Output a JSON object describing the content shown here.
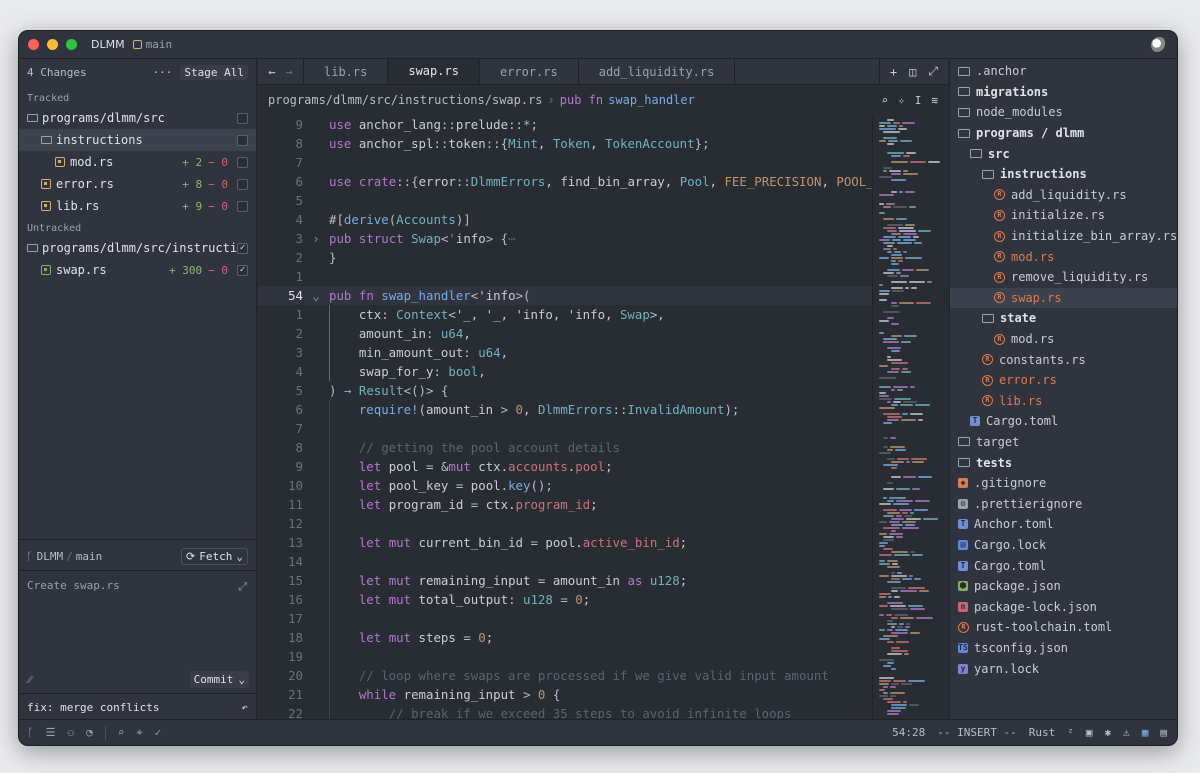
{
  "titlebar": {
    "project": "DLMM",
    "branch": "main"
  },
  "git_panel": {
    "changes_count": "4 Changes",
    "more": "···",
    "stage_all": "Stage All",
    "tracked_label": "Tracked",
    "untracked_label": "Untracked",
    "tracked": [
      {
        "label": "programs/dlmm/src"
      },
      {
        "label": "instructions"
      },
      {
        "label": "mod.rs",
        "add": "+ 2",
        "del": "− 0"
      },
      {
        "label": "error.rs",
        "add": "+ 8",
        "del": "− 0"
      },
      {
        "label": "lib.rs",
        "add": "+ 9",
        "del": "− 0"
      }
    ],
    "untracked": [
      {
        "label": "programs/dlmm/src/instructi…"
      },
      {
        "label": "swap.rs",
        "add": "+ 300",
        "del": "− 0"
      }
    ],
    "repo": "DLMM",
    "branch": "main",
    "fetch": "Fetch",
    "commit_placeholder": "Create swap.rs",
    "commit_button": "Commit",
    "last_commit": "fix: merge conflicts"
  },
  "tabs": [
    "lib.rs",
    "swap.rs",
    "error.rs",
    "add_liquidity.rs"
  ],
  "active_tab": "swap.rs",
  "breadcrumb": {
    "path": "programs/dlmm/src/instructions/swap.rs",
    "kw": "pub fn",
    "fn": "swap_handler"
  },
  "code_lines": [
    {
      "n": "9",
      "html": "<span class='k'>use</span> anchor_lang<span class='p'>::</span>prelude<span class='p'>::*;</span>"
    },
    {
      "n": "8",
      "html": "<span class='k'>use</span> anchor_spl<span class='p'>::</span>token<span class='p'>::{</span><span class='t'>Mint</span>, <span class='t'>Token</span>, <span class='t'>TokenAccount</span><span class='p'>};</span>"
    },
    {
      "n": "7",
      "html": ""
    },
    {
      "n": "6",
      "html": "<span class='k'>use</span> <span class='k'>crate</span><span class='p'>::{</span>error<span class='p'>::</span><span class='t'>DlmmErrors</span>, find_bin_array, <span class='t'>Pool</span>, <span class='n'>FEE_PRECISION</span>, <span class='n'>POOL_SEE</span>"
    },
    {
      "n": "5",
      "html": ""
    },
    {
      "n": "4",
      "html": "<span class='p'>#[</span><span class='f'>derive</span><span class='p'>(</span><span class='t'>Accounts</span><span class='p'>)]</span>"
    },
    {
      "n": "3",
      "fold": "›",
      "html": "<span class='k'>pub</span> <span class='k'>struct</span> <span class='t'>Swap</span><span class='p'>&lt;</span><span class='fld'>'</span>info<span class='p'>&gt; {</span><span class='c'>⋯</span>"
    },
    {
      "n": "2",
      "html": "<span class='p'>}</span>"
    },
    {
      "n": "1",
      "html": ""
    },
    {
      "n": "54",
      "cur": true,
      "fold": "⌄",
      "html": "<span class='k'>pub</span> <span class='k'>fn</span> <span class='f'>swap_handler</span><span class='p'>&lt;</span>'info<span class='p'>&gt;(</span>"
    },
    {
      "n": "1",
      "html": "    ctx<span class='p'>:</span> <span class='t'>Context</span><span class='p'>&lt;</span>'_, '_, 'info, 'info, <span class='t'>Swap</span><span class='p'>&gt;,</span>"
    },
    {
      "n": "2",
      "html": "    amount_in<span class='p'>:</span> <span class='t'>u64</span>,"
    },
    {
      "n": "3",
      "html": "    min_amount_out<span class='p'>:</span> <span class='t'>u64</span>,"
    },
    {
      "n": "4",
      "html": "    swap_for_y<span class='p'>:</span> <span class='t'>bool</span>,"
    },
    {
      "n": "5",
      "html": "<span class='p'>)</span> <span class='f'>→</span> <span class='t'>Result</span><span class='p'>&lt;()&gt; {</span>"
    },
    {
      "n": "6",
      "html": "    <span class='f'>require!</span><span class='p'>(</span>amount_in <span class='p'>&gt;</span> <span class='n'>0</span>, <span class='t'>DlmmErrors</span><span class='p'>::</span><span class='t'>InvalidAmount</span><span class='p'>);</span>"
    },
    {
      "n": "7",
      "html": ""
    },
    {
      "n": "8",
      "html": "    <span class='c'>// getting the pool account details</span>"
    },
    {
      "n": "9",
      "html": "    <span class='k'>let</span> pool <span class='p'>=</span> <span class='p'>&amp;</span><span class='k'>mut</span> ctx.<span class='fld'>accounts</span>.<span class='fld'>pool</span>;"
    },
    {
      "n": "10",
      "html": "    <span class='k'>let</span> pool_key <span class='p'>=</span> pool.<span class='f'>key</span><span class='p'>();</span>"
    },
    {
      "n": "11",
      "html": "    <span class='k'>let</span> program_id <span class='p'>=</span> ctx.<span class='fld'>program_id</span>;"
    },
    {
      "n": "12",
      "html": ""
    },
    {
      "n": "13",
      "html": "    <span class='k'>let</span> <span class='k'>mut</span> current_bin_id <span class='p'>=</span> pool.<span class='fld'>active_bin_id</span>;"
    },
    {
      "n": "14",
      "html": ""
    },
    {
      "n": "15",
      "html": "    <span class='k'>let</span> <span class='k'>mut</span> remaining_input <span class='p'>=</span> amount_in <span class='k'>as</span> <span class='t'>u128</span>;"
    },
    {
      "n": "16",
      "html": "    <span class='k'>let</span> <span class='k'>mut</span> total_output<span class='p'>:</span> <span class='t'>u128</span> <span class='p'>=</span> <span class='n'>0</span>;"
    },
    {
      "n": "17",
      "html": ""
    },
    {
      "n": "18",
      "html": "    <span class='k'>let</span> <span class='k'>mut</span> steps <span class='p'>=</span> <span class='n'>0</span>;"
    },
    {
      "n": "19",
      "html": ""
    },
    {
      "n": "20",
      "html": "    <span class='c'>// loop where swaps are processed if we give valid input amount</span>"
    },
    {
      "n": "21",
      "html": "    <span class='k'>while</span> remaining_input <span class='p'>&gt;</span> <span class='n'>0</span> <span class='p'>{</span>"
    },
    {
      "n": "22",
      "html": "        <span class='c'>// break if we exceed 35 steps to avoid infinite loops</span>"
    }
  ],
  "file_tree": [
    {
      "label": ".anchor",
      "icon": "folder",
      "depth": 0
    },
    {
      "label": "migrations",
      "icon": "folder",
      "depth": 0,
      "bold": true
    },
    {
      "label": "node_modules",
      "icon": "folder",
      "depth": 0
    },
    {
      "label": "programs / dlmm",
      "icon": "folder",
      "depth": 0,
      "bold": true
    },
    {
      "label": "src",
      "icon": "folder",
      "depth": 1,
      "bold": true
    },
    {
      "label": "instructions",
      "icon": "folder",
      "depth": 2,
      "bold": true
    },
    {
      "label": "add_liquidity.rs",
      "icon": "rs",
      "depth": 3
    },
    {
      "label": "initialize.rs",
      "icon": "rs",
      "depth": 3
    },
    {
      "label": "initialize_bin_array.rs",
      "icon": "rs",
      "depth": 3
    },
    {
      "label": "mod.rs",
      "icon": "rs",
      "depth": 3,
      "modified": true
    },
    {
      "label": "remove_liquidity.rs",
      "icon": "rs",
      "depth": 3
    },
    {
      "label": "swap.rs",
      "icon": "rs",
      "depth": 3,
      "modified": true,
      "selected": true
    },
    {
      "label": "state",
      "icon": "folder",
      "depth": 2,
      "bold": true
    },
    {
      "label": "mod.rs",
      "icon": "rs",
      "depth": 3
    },
    {
      "label": "constants.rs",
      "icon": "rs",
      "depth": 2
    },
    {
      "label": "error.rs",
      "icon": "rs",
      "depth": 2,
      "modified": true
    },
    {
      "label": "lib.rs",
      "icon": "rs",
      "depth": 2,
      "modified": true
    },
    {
      "label": "Cargo.toml",
      "icon": "toml",
      "depth": 1
    },
    {
      "label": "target",
      "icon": "folder",
      "depth": 0
    },
    {
      "label": "tests",
      "icon": "folder",
      "depth": 0,
      "bold": true
    },
    {
      "label": ".gitignore",
      "icon": "git",
      "depth": 0
    },
    {
      "label": ".prettierignore",
      "icon": "gear",
      "depth": 0
    },
    {
      "label": "Anchor.toml",
      "icon": "toml",
      "depth": 0
    },
    {
      "label": "Cargo.lock",
      "icon": "lock",
      "depth": 0
    },
    {
      "label": "Cargo.toml",
      "icon": "toml",
      "depth": 0
    },
    {
      "label": "package.json",
      "icon": "node",
      "depth": 0
    },
    {
      "label": "package-lock.json",
      "icon": "npm",
      "depth": 0
    },
    {
      "label": "rust-toolchain.toml",
      "icon": "rs",
      "depth": 0
    },
    {
      "label": "tsconfig.json",
      "icon": "ts",
      "depth": 0
    },
    {
      "label": "yarn.lock",
      "icon": "yarn",
      "depth": 0
    }
  ],
  "status": {
    "cursor": "54:28",
    "mode": "-- INSERT --",
    "language": "Rust"
  },
  "colors": {
    "accent": "#73ade9",
    "modified": "#e07b4f",
    "added": "#8fb86a",
    "deleted": "#d3636b"
  }
}
